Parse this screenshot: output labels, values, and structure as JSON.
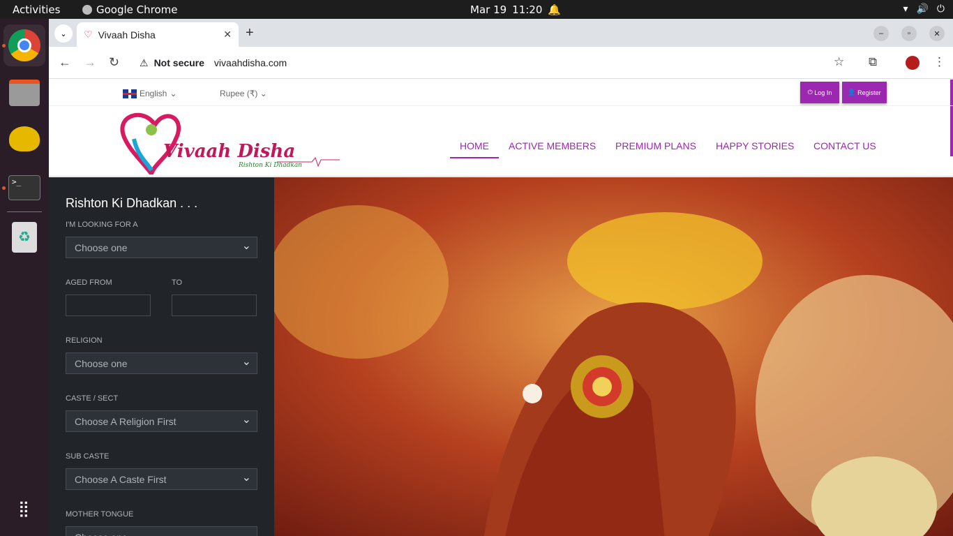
{
  "os": {
    "activities": "Activities",
    "app_name": "Google Chrome",
    "date": "Mar 19",
    "time": "11:20"
  },
  "browser": {
    "tab_title": "Vivaah Disha",
    "security": "Not secure",
    "url": "vivaahdisha.com"
  },
  "site": {
    "language": "English",
    "currency": "Rupee (₹)",
    "login": "Log In",
    "register": "Register",
    "logo_text": "Vivaah Disha",
    "logo_tagline": "Rishton Ki Dhadkan",
    "nav": [
      "HOME",
      "ACTIVE MEMBERS",
      "PREMIUM PLANS",
      "HAPPY STORIES",
      "CONTACT US"
    ],
    "search": {
      "title": "Rishton Ki Dhadkan . . .",
      "looking_for_label": "I'M LOOKING FOR A",
      "looking_for_value": "Choose one",
      "aged_from_label": "AGED FROM",
      "to_label": "TO",
      "religion_label": "RELIGION",
      "religion_value": "Choose one",
      "caste_label": "CASTE / SECT",
      "caste_value": "Choose A Religion First",
      "subcaste_label": "SUB CASTE",
      "subcaste_value": "Choose A Caste First",
      "tongue_label": "MOTHER TONGUE",
      "tongue_value": "Choose one"
    }
  },
  "colors": {
    "accent": "#9c27b0",
    "sidebar": "#212529"
  }
}
